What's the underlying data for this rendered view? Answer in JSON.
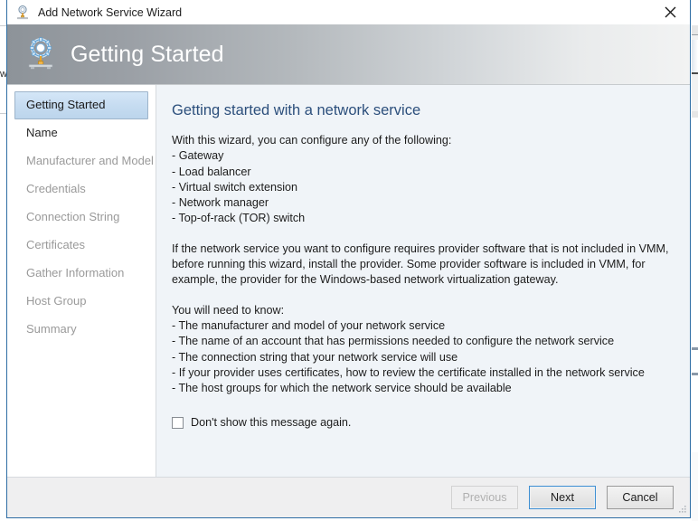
{
  "window": {
    "title": "Add Network Service Wizard",
    "icon": "network-service-icon",
    "close_label": "✕",
    "border_color": "#2e6da4"
  },
  "header": {
    "title": "Getting Started",
    "icon": "network-service-icon",
    "gradient_from": "#8d9399",
    "gradient_to": "#f2f3f3",
    "text_color": "#ffffff"
  },
  "sidebar": {
    "items": [
      {
        "label": "Getting Started",
        "state": "selected"
      },
      {
        "label": "Name",
        "state": "enabled"
      },
      {
        "label": "Manufacturer and Model",
        "state": "disabled"
      },
      {
        "label": "Credentials",
        "state": "disabled"
      },
      {
        "label": "Connection String",
        "state": "disabled"
      },
      {
        "label": "Certificates",
        "state": "disabled"
      },
      {
        "label": "Gather Information",
        "state": "disabled"
      },
      {
        "label": "Host Group",
        "state": "disabled"
      },
      {
        "label": "Summary",
        "state": "disabled"
      }
    ],
    "selected_bg": "#c6dcf1"
  },
  "content": {
    "title": "Getting started with a network service",
    "title_color": "#2c4f7c",
    "intro": "With this wizard, you can configure any of the following:",
    "configure_list": [
      "- Gateway",
      "- Load balancer",
      "- Virtual switch extension",
      "- Network manager",
      "- Top-of-rack (TOR) switch"
    ],
    "provider_paragraph": "If the network service you want to configure requires provider software that is not included in VMM, before running this wizard, install the provider. Some provider software is included in VMM, for example, the provider for the Windows-based network virtualization gateway.",
    "need_to_know_intro": "You will need to know:",
    "need_to_know_list": [
      "- The manufacturer and model of your network service",
      "- The name of an account that has permissions needed to configure the network service",
      "- The connection string that your network service will use",
      "- If your provider uses certificates, how to review the certificate installed in the network service",
      "- The host groups for which the network service should be available"
    ],
    "checkbox": {
      "label": "Don't show this message again.",
      "checked": false
    }
  },
  "footer": {
    "buttons": [
      {
        "label": "Previous",
        "state": "disabled"
      },
      {
        "label": "Next",
        "state": "default"
      },
      {
        "label": "Cancel",
        "state": "normal"
      }
    ],
    "background": "#efeff0"
  },
  "background": {
    "left_window_text": "w"
  }
}
